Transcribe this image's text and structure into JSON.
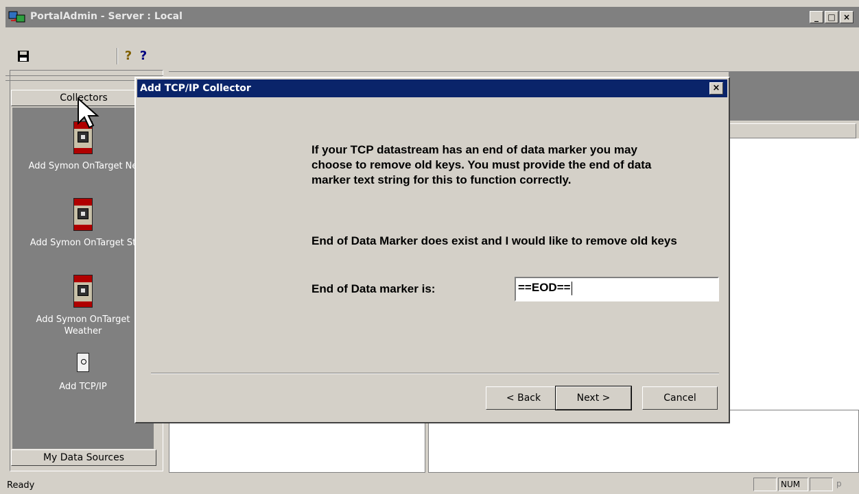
{
  "window": {
    "title": "PortalAdmin - Server : Local",
    "controls": [
      "_",
      "□",
      "×"
    ]
  },
  "toolbar": {
    "help_glyph": "?",
    "whats_this_glyph": "?"
  },
  "left_panel": {
    "collectors_label": "Collectors",
    "items": [
      {
        "label": "Add Symon OnTarget Ne"
      },
      {
        "label": "Add Symon OnTarget St"
      },
      {
        "label_line1": "Add Symon OnTarget",
        "label_line2": "Weather"
      },
      {
        "label": "Add TCP/IP"
      }
    ],
    "my_data_sources_label": "My Data Sources"
  },
  "dialog": {
    "title": "Add TCP/IP Collector",
    "close_label": "×",
    "description": "If your TCP datastream has an end of data marker you may\nchoose to remove old keys.  You must provide the end of data\nmarker text string for this to function correctly.",
    "option_text": "End of Data Marker does exist and I would like to remove old keys",
    "marker_label": "End of Data marker is:",
    "marker_value": "==EOD==",
    "buttons": {
      "back": "< Back",
      "next": "Next >",
      "cancel": "Cancel"
    }
  },
  "statusbar": {
    "status": "Ready",
    "num": "NUM",
    "last": "p"
  }
}
